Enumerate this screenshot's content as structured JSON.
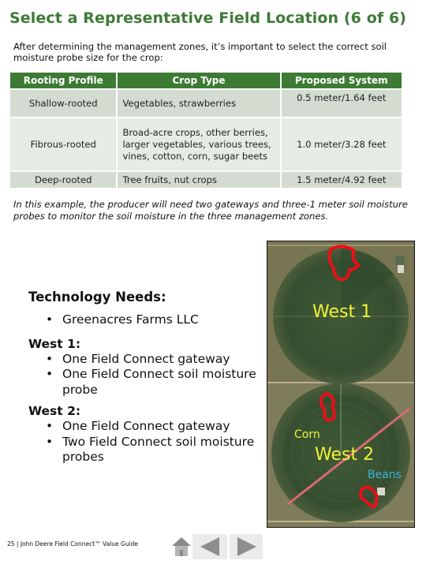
{
  "page": {
    "title": "Select a Representative Field Location (6 of 6)",
    "intro": "After determining the management zones, it’s important to select the correct soil moisture probe size for the crop:",
    "example": "In this example, the producer will need two gateways and three-1 meter soil moisture probes to monitor the soil moisture in the three management zones."
  },
  "table": {
    "headers": [
      "Rooting Profile",
      "Crop Type",
      "Proposed System"
    ],
    "rows": [
      {
        "profile": "Shallow-rooted",
        "crop": "Vegetables, strawberries",
        "system": "0.5 meter/1.64 feet"
      },
      {
        "profile": "Fibrous-rooted",
        "crop": "Broad-acre crops, other berries, larger vegetables, various trees, vines, cotton, corn, sugar beets",
        "system": "1.0 meter/3.28 feet"
      },
      {
        "profile": "Deep-rooted",
        "crop": "Tree fruits, nut crops",
        "system": "1.5 meter/4.92 feet"
      }
    ],
    "colors": {
      "header_bg": "#3d7b34",
      "row_bg": "#d4dbd1",
      "alt_row_bg": "#e6ebe4"
    }
  },
  "technology": {
    "heading": "Technology Needs:",
    "company": "Greenacres Farms LLC",
    "zones": [
      {
        "label": "West 1:",
        "items": [
          "One Field Connect gateway",
          "One Field Connect soil moisture probe"
        ]
      },
      {
        "label": "West 2:",
        "items": [
          "One Field Connect gateway",
          "Two Field Connect soil moisture probes"
        ]
      }
    ]
  },
  "map": {
    "labels": {
      "west1": "West 1",
      "west2": "West 2",
      "corn": "Corn",
      "beans": "Beans"
    },
    "colors": {
      "zone_label": "#f2f23a",
      "beans_label": "#3cb4d8",
      "probe_outline": "#e8101a",
      "divider_line": "#d86a72"
    }
  },
  "footer": {
    "text": "25 | John Deere Field Connect™ Value Guide",
    "nav": {
      "home": "home-icon",
      "prev": "previous-arrow-icon",
      "next": "next-arrow-icon"
    }
  }
}
